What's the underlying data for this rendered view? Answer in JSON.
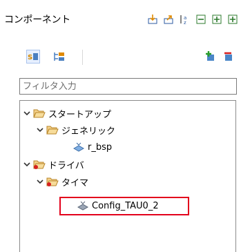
{
  "panel": {
    "title": "コンポーネント"
  },
  "filter": {
    "placeholder": "フィルタ入力"
  },
  "tree": [
    {
      "label": "スタートアップ",
      "icon": "folder-open-icon",
      "expanded": true
    },
    {
      "label": "ジェネリック",
      "icon": "folder-open-icon",
      "expanded": true
    },
    {
      "label": "r_bsp",
      "icon": "component-icon"
    },
    {
      "label": "ドライバ",
      "icon": "folder-open-icon",
      "expanded": true
    },
    {
      "label": "タイマ",
      "icon": "folder-open-icon",
      "expanded": true
    },
    {
      "label": "Config_TAU0_2",
      "icon": "component-icon",
      "highlighted": true
    }
  ],
  "colors": {
    "highlight": "#e3001b",
    "folder": "#e8b04a",
    "warning": "#d62020"
  }
}
